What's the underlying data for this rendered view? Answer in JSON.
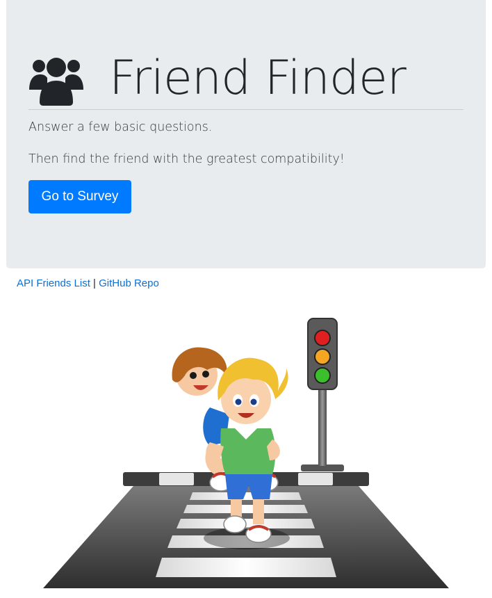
{
  "header": {
    "title": "Friend Finder",
    "icon": "users-icon"
  },
  "intro": {
    "line1": "Answer a few basic questions.",
    "line2": "Then find the friend with the greatest compatibility!"
  },
  "buttons": {
    "survey_label": "Go to Survey"
  },
  "links": {
    "api_label": "API Friends List",
    "separator": "|",
    "github_label": "GitHub Repo"
  },
  "colors": {
    "jumbotron_bg": "#e9ecef",
    "primary": "#007bff",
    "link": "#0a6fd6",
    "text": "#212529"
  },
  "illustration": {
    "subject": "two boys piggyback crossing zebra crosswalk with traffic light"
  }
}
